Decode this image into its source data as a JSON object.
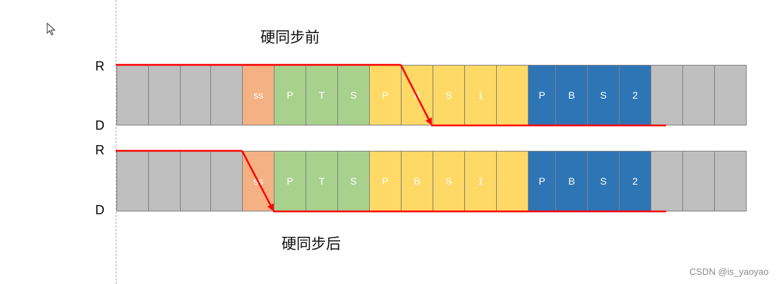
{
  "titles": {
    "before": "硬同步前",
    "after": "硬同步后"
  },
  "signal_labels": {
    "r": "R",
    "d": "D"
  },
  "watermark": "CSDN @is_yaoyao",
  "colors": {
    "gray": "#bfbfbf",
    "orange": "#f4b183",
    "green": "#a9d18e",
    "yellow": "#ffd966",
    "blue": "#2e75b6",
    "signal": "#ff0000"
  },
  "segments": [
    {
      "label": "",
      "color": "gray"
    },
    {
      "label": "",
      "color": "gray"
    },
    {
      "label": "",
      "color": "gray"
    },
    {
      "label": "",
      "color": "gray"
    },
    {
      "label": "ss",
      "color": "orange"
    },
    {
      "label": "P",
      "color": "green"
    },
    {
      "label": "T",
      "color": "green"
    },
    {
      "label": "S",
      "color": "green"
    },
    {
      "label": "P",
      "color": "yellow"
    },
    {
      "label": "B",
      "color": "yellow"
    },
    {
      "label": "S",
      "color": "yellow"
    },
    {
      "label": "1",
      "color": "yellow"
    },
    {
      "label": "",
      "color": "yellow"
    },
    {
      "label": "P",
      "color": "blue"
    },
    {
      "label": "B",
      "color": "blue"
    },
    {
      "label": "S",
      "color": "blue"
    },
    {
      "label": "2",
      "color": "blue"
    },
    {
      "label": "",
      "color": "gray"
    },
    {
      "label": "",
      "color": "gray"
    },
    {
      "label": "",
      "color": "gray"
    }
  ]
}
